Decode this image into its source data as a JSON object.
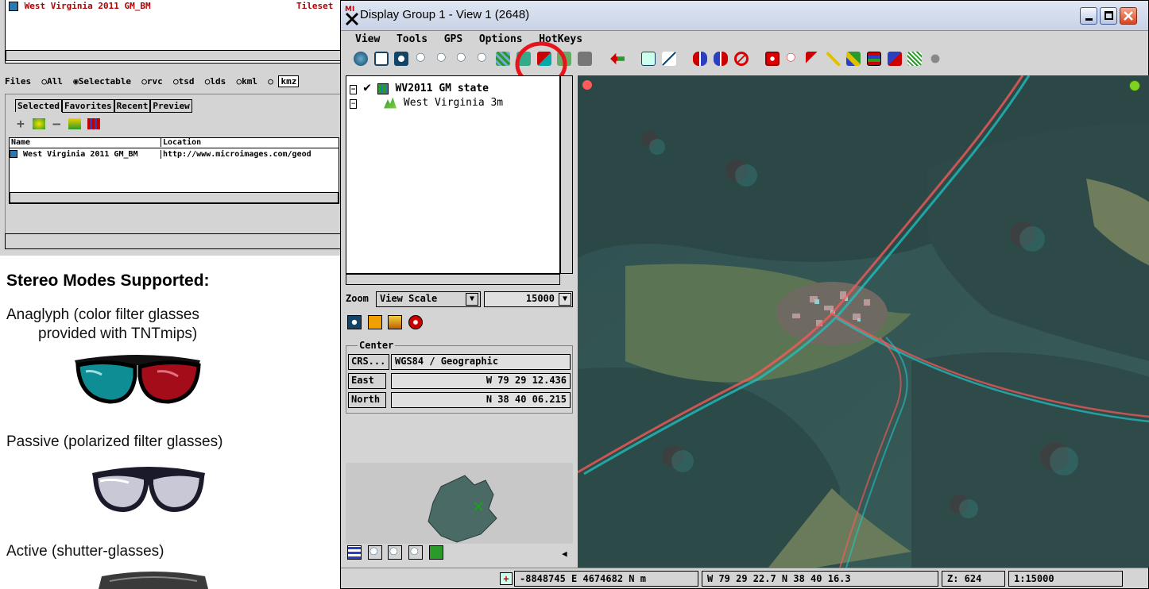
{
  "left": {
    "top_item": {
      "name": "West Virginia 2011 GM_BM",
      "type": "Tileset"
    },
    "files_label": "Files",
    "filters": [
      "All",
      "Selectable",
      "rvc",
      "tsd",
      "lds",
      "kml"
    ],
    "filter_input": "kmz",
    "tabs": [
      "Selected",
      "Favorites",
      "Recent",
      "Preview"
    ],
    "columns": [
      "Name",
      "Location"
    ],
    "row": {
      "name": "West Virginia 2011 GM_BM",
      "location": "http://www.microimages.com/geod"
    }
  },
  "notes": {
    "heading": "Stereo Modes Supported:",
    "anaglyph_line1": "Anaglyph (color filter glasses",
    "anaglyph_line2": "provided with TNTmips)",
    "passive": "Passive (polarized filter glasses)",
    "active": "Active (shutter-glasses)"
  },
  "window": {
    "title": "Display Group 1 - View 1 (2648)",
    "menu": [
      "View",
      "Tools",
      "GPS",
      "Options",
      "HotKeys"
    ],
    "layers": [
      {
        "name": "WV2011 GM state",
        "checked": true
      },
      {
        "name": "West Virginia 3m",
        "checked": false
      }
    ],
    "zoom": {
      "label": "Zoom",
      "mode": "View Scale",
      "value": "15000"
    },
    "center": {
      "title": "Center",
      "crs_button": "CRS...",
      "crs_value": "WGS84 / Geographic",
      "east_label": "East",
      "east_value": "W 79 29 12.436",
      "north_label": "North",
      "north_value": "N 38 40 06.215"
    },
    "status": {
      "projected": "-8848745 E  4674682 N m",
      "geographic": "W 79 29 22.7  N 38 40 16.3",
      "z": "Z: 624",
      "scale": "1:15000"
    }
  },
  "colors": {
    "highlight_circle": "#e8141c",
    "accent_red": "#ff5a5a",
    "accent_cyan": "#1fc4c4"
  }
}
